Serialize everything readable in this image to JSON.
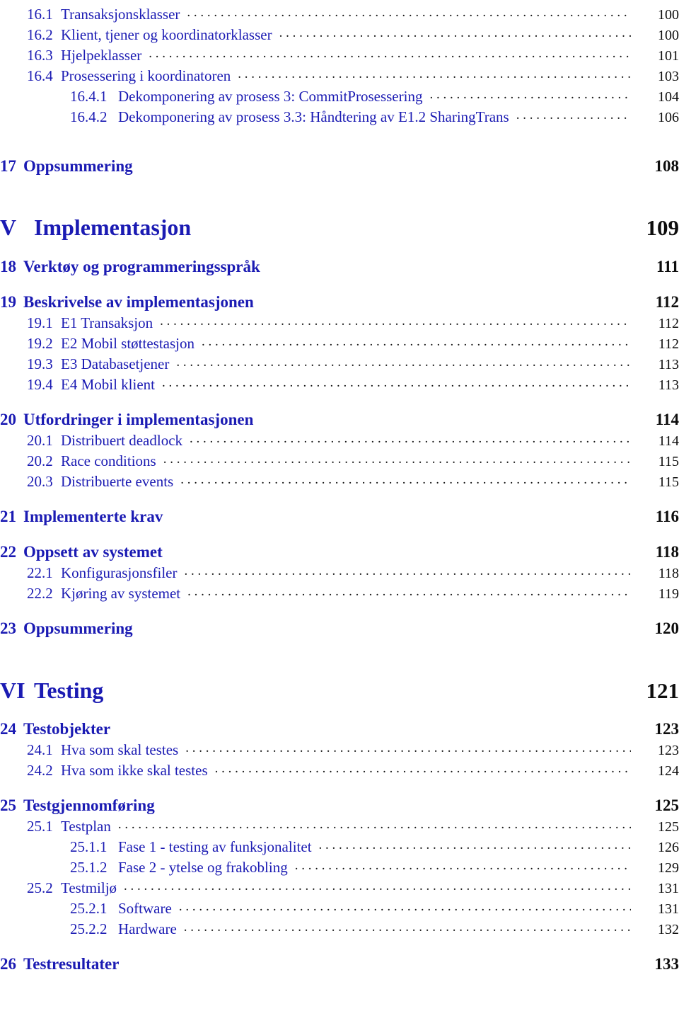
{
  "document": {
    "kind": "table-of-contents",
    "language": "Norwegian",
    "colors": {
      "entry_blue": "#1b1bb3",
      "page_number_black": "#0d0d0d",
      "leader_dots": "#151515",
      "background": "#ffffff"
    }
  },
  "entries": [
    {
      "level": "section",
      "number": "16.1",
      "title": "Transaksjonsklasser",
      "page": "100"
    },
    {
      "level": "section",
      "number": "16.2",
      "title": "Klient, tjener og koordinatorklasser",
      "page": "100"
    },
    {
      "level": "section",
      "number": "16.3",
      "title": "Hjelpeklasser",
      "page": "101"
    },
    {
      "level": "section",
      "number": "16.4",
      "title": "Prosessering i koordinatoren",
      "page": "103"
    },
    {
      "level": "subsection",
      "number": "16.4.1",
      "title": "Dekomponering av prosess 3: CommitProsessering",
      "page": "104"
    },
    {
      "level": "subsection",
      "number": "16.4.2",
      "title": "Dekomponering av prosess 3.3: Håndtering av E1.2 SharingTrans",
      "page": "106"
    },
    {
      "level": "chapter",
      "number": "17",
      "title": "Oppsummering",
      "page": "108"
    },
    {
      "level": "part",
      "number": "V",
      "title": "Implementasjon",
      "page": "109"
    },
    {
      "level": "chapter",
      "number": "18",
      "title": "Verktøy og programmeringsspråk",
      "page": "111"
    },
    {
      "level": "chapter",
      "number": "19",
      "title": "Beskrivelse av implementasjonen",
      "page": "112"
    },
    {
      "level": "section",
      "number": "19.1",
      "title": "E1 Transaksjon",
      "page": "112"
    },
    {
      "level": "section",
      "number": "19.2",
      "title": "E2 Mobil støttestasjon",
      "page": "112"
    },
    {
      "level": "section",
      "number": "19.3",
      "title": "E3 Databasetjener",
      "page": "113"
    },
    {
      "level": "section",
      "number": "19.4",
      "title": "E4 Mobil klient",
      "page": "113"
    },
    {
      "level": "chapter",
      "number": "20",
      "title": "Utfordringer i implementasjonen",
      "page": "114"
    },
    {
      "level": "section",
      "number": "20.1",
      "title": "Distribuert deadlock",
      "page": "114"
    },
    {
      "level": "section",
      "number": "20.2",
      "title": "Race conditions",
      "page": "115"
    },
    {
      "level": "section",
      "number": "20.3",
      "title": "Distribuerte events",
      "page": "115"
    },
    {
      "level": "chapter",
      "number": "21",
      "title": "Implementerte krav",
      "page": "116"
    },
    {
      "level": "chapter",
      "number": "22",
      "title": "Oppsett av systemet",
      "page": "118"
    },
    {
      "level": "section",
      "number": "22.1",
      "title": "Konfigurasjonsfiler",
      "page": "118"
    },
    {
      "level": "section",
      "number": "22.2",
      "title": "Kjøring av systemet",
      "page": "119"
    },
    {
      "level": "chapter",
      "number": "23",
      "title": "Oppsummering",
      "page": "120"
    },
    {
      "level": "part",
      "number": "VI",
      "title": "Testing",
      "page": "121"
    },
    {
      "level": "chapter",
      "number": "24",
      "title": "Testobjekter",
      "page": "123"
    },
    {
      "level": "section",
      "number": "24.1",
      "title": "Hva som skal testes",
      "page": "123"
    },
    {
      "level": "section",
      "number": "24.2",
      "title": "Hva som ikke skal testes",
      "page": "124"
    },
    {
      "level": "chapter",
      "number": "25",
      "title": "Testgjennomføring",
      "page": "125"
    },
    {
      "level": "section",
      "number": "25.1",
      "title": "Testplan",
      "page": "125"
    },
    {
      "level": "subsection",
      "number": "25.1.1",
      "title": "Fase 1 - testing av funksjonalitet",
      "page": "126"
    },
    {
      "level": "subsection",
      "number": "25.1.2",
      "title": "Fase 2 - ytelse og frakobling",
      "page": "129"
    },
    {
      "level": "section",
      "number": "25.2",
      "title": "Testmiljø",
      "page": "131"
    },
    {
      "level": "subsection",
      "number": "25.2.1",
      "title": "Software",
      "page": "131"
    },
    {
      "level": "subsection",
      "number": "25.2.2",
      "title": "Hardware",
      "page": "132"
    },
    {
      "level": "chapter",
      "number": "26",
      "title": "Testresultater",
      "page": "133"
    }
  ],
  "gaps": {
    "0": "none",
    "5": "large",
    "6": "xlarge",
    "7": "medium",
    "8": "medium",
    "13": "medium",
    "17": "medium",
    "18": "medium",
    "21": "medium",
    "22": "xlarge",
    "23": "medium",
    "26": "medium",
    "33": "medium"
  }
}
